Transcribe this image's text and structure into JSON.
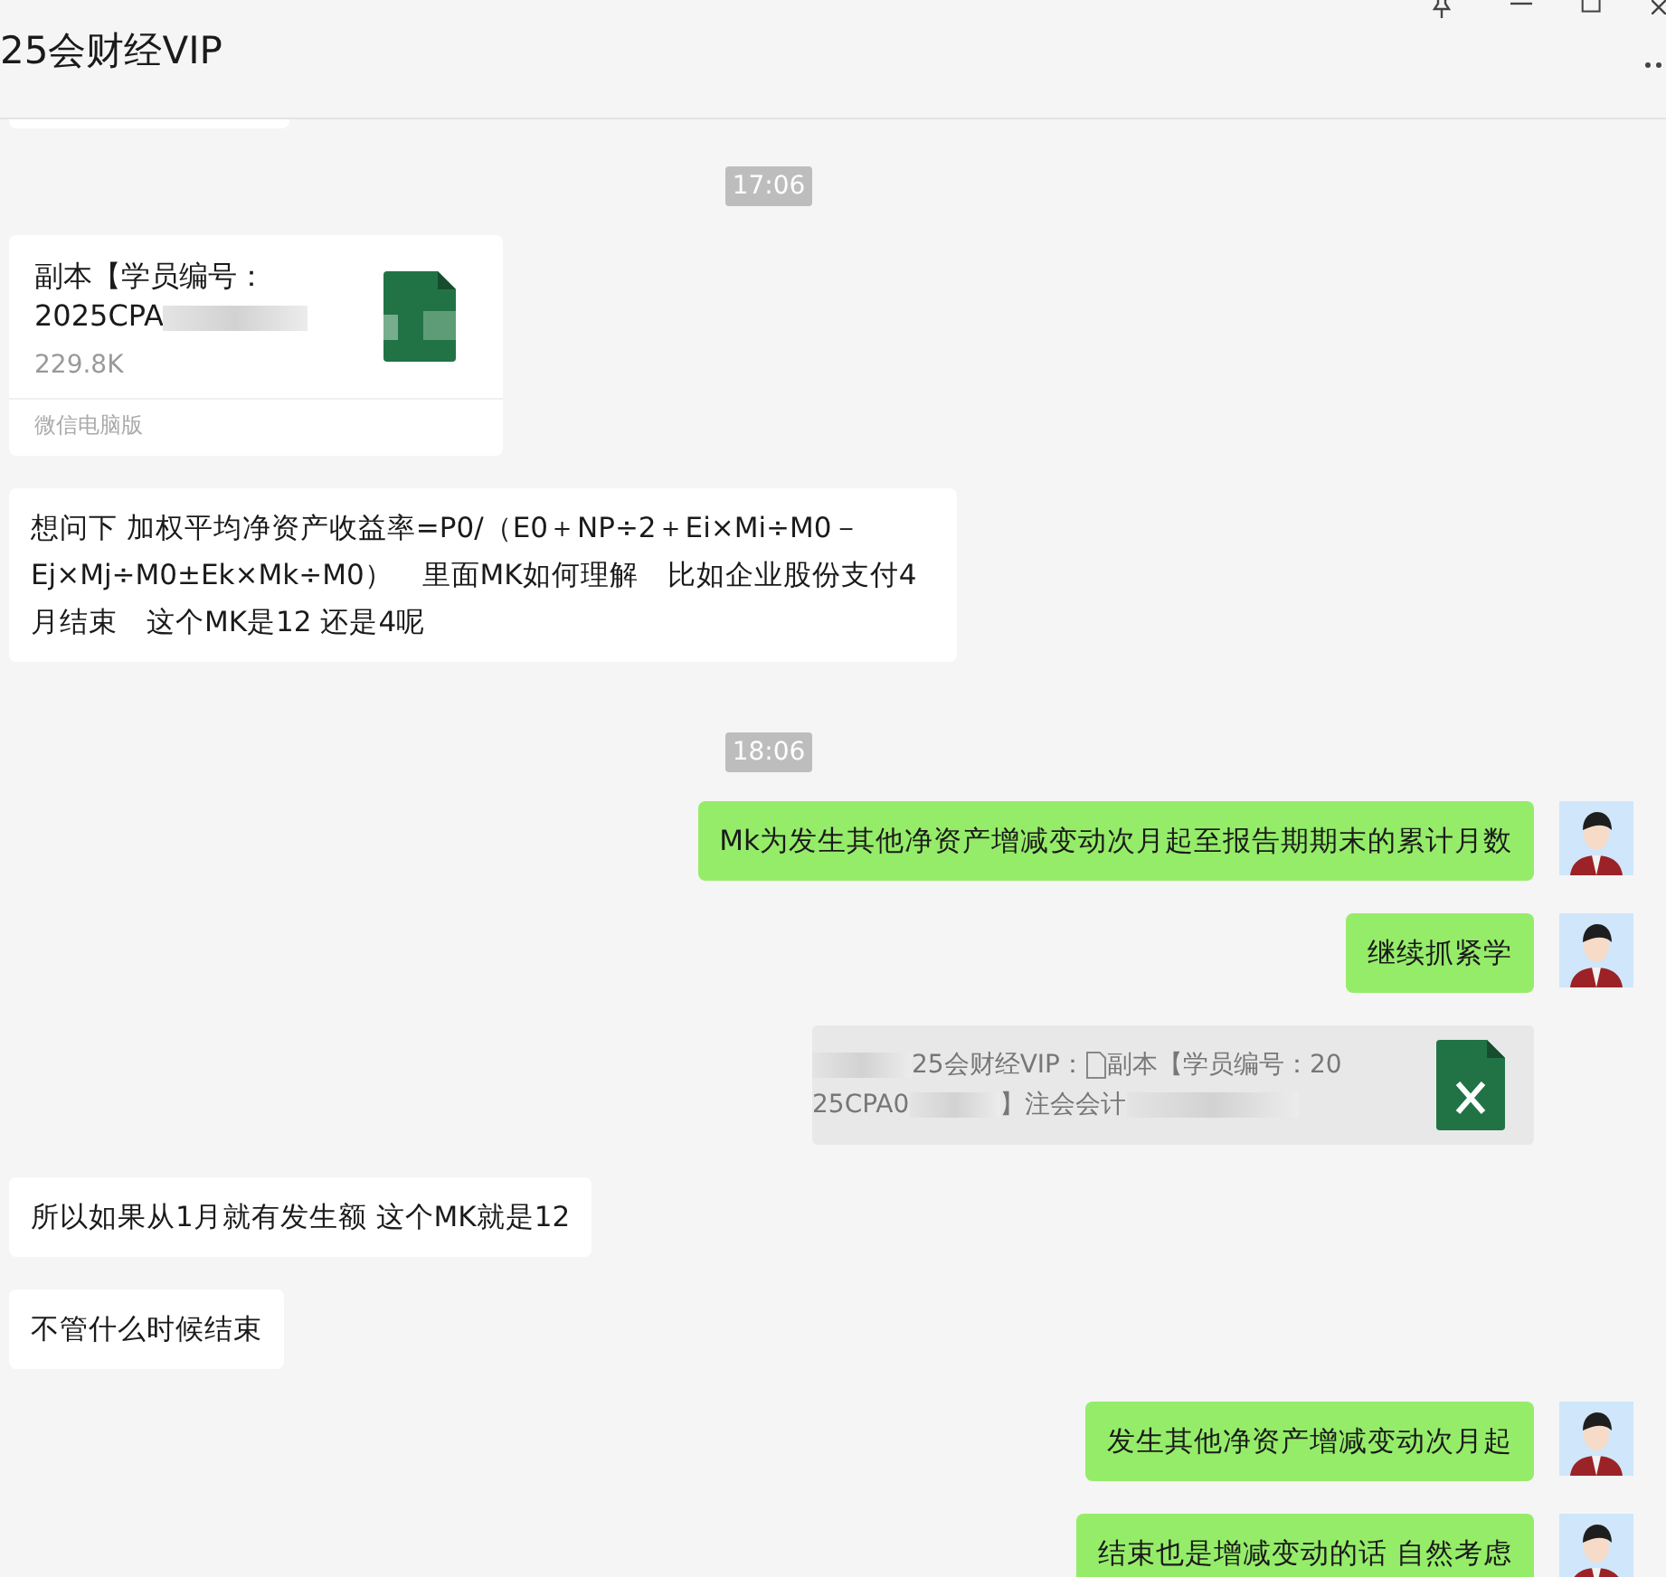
{
  "window": {
    "title": "25会财经VIP"
  },
  "messages": [
    {
      "kind": "clipped"
    },
    {
      "kind": "time",
      "text": "17:06"
    },
    {
      "kind": "file",
      "outgoing": false,
      "name_lines": [
        "副本【学员编号：",
        "2025CPA"
      ],
      "size": "229.8K",
      "source": "微信电脑版"
    },
    {
      "kind": "text",
      "outgoing": false,
      "text": "想问下 加权平均净资产收益率=P0/（E0＋NP÷2＋Ei×Mi÷M0－Ej×Mj÷M0±Ek×Mk÷M0）　里面MK如何理解　比如企业股份支付4月结束　这个MK是12 还是4呢"
    },
    {
      "kind": "time",
      "text": "18:06"
    },
    {
      "kind": "text",
      "outgoing": true,
      "text": "Mk为发生其他净资产增减变动次月起至报告期期末的累计月数"
    },
    {
      "kind": "text",
      "outgoing": true,
      "text": "继续抓紧学"
    },
    {
      "kind": "quote",
      "sender": "25会财经VIP：",
      "title": "副本【学员编号：20",
      "line2_start": "25CPA0",
      "line2_mid": "】注会会计"
    },
    {
      "kind": "text",
      "outgoing": false,
      "text": "所以如果从1月就有发生额 这个MK就是12"
    },
    {
      "kind": "text",
      "outgoing": false,
      "text": "不管什么时候结束"
    },
    {
      "kind": "text",
      "outgoing": true,
      "text": "发生其他净资产增减变动次月起"
    },
    {
      "kind": "text",
      "outgoing": true,
      "text": "结束也是增减变动的话 自然考虑"
    }
  ]
}
